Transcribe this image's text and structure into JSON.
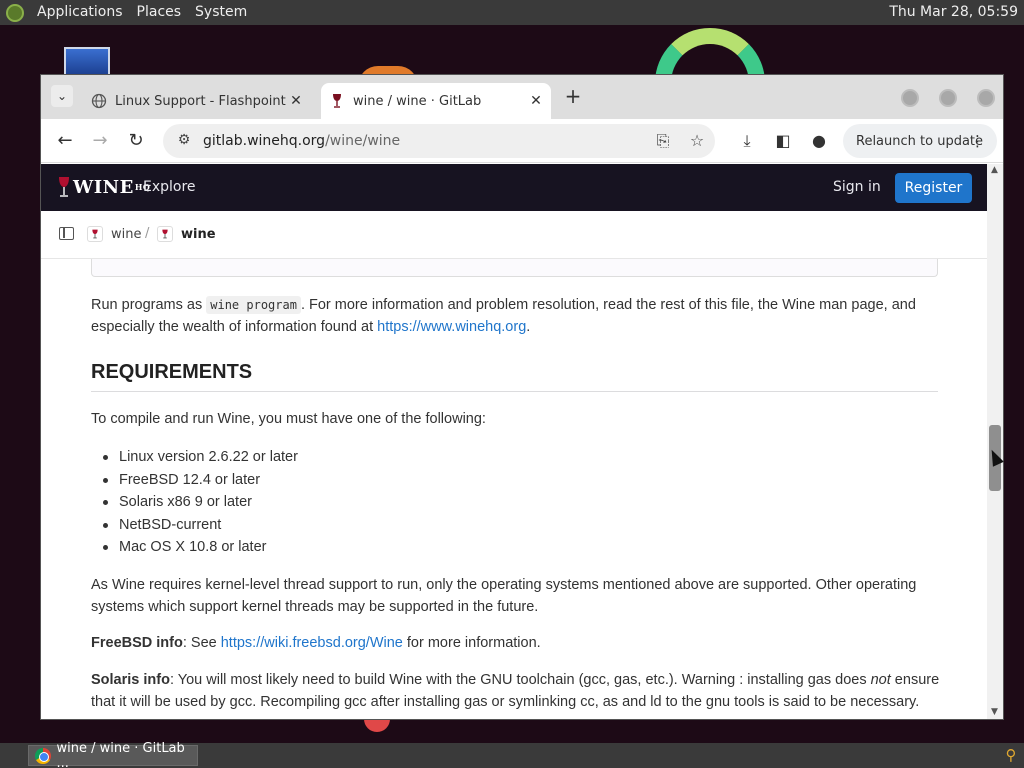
{
  "top_panel": {
    "menus": [
      "Applications",
      "Places",
      "System"
    ],
    "clock": "Thu Mar 28, 05:59"
  },
  "browser": {
    "tabs": [
      {
        "title": "Linux Support - Flashpoint Da",
        "active": false
      },
      {
        "title": "wine / wine · GitLab",
        "active": true
      }
    ],
    "url_host": "gitlab.winehq.org",
    "url_path": "/wine/wine",
    "relaunch_label": "Relaunch to update"
  },
  "gitlab": {
    "logo_text": "WINE",
    "logo_sup": "HQ",
    "explore": "Explore",
    "sign_in": "Sign in",
    "register": "Register",
    "breadcrumb": [
      "wine",
      "wine"
    ],
    "breadcrumb_sep": "/"
  },
  "content": {
    "p1_pre": "Run programs as ",
    "p1_code": "wine program",
    "p1_mid": ". For more information and problem resolution, read the rest of this file, the Wine man page, and especially the wealth of information found at ",
    "p1_link": "https://www.winehq.org",
    "p1_post": ".",
    "heading": "REQUIREMENTS",
    "p2": "To compile and run Wine, you must have one of the following:",
    "list": [
      "Linux version 2.6.22 or later",
      "FreeBSD 12.4 or later",
      "Solaris x86 9 or later",
      "NetBSD-current",
      "Mac OS X 10.8 or later"
    ],
    "p3": "As Wine requires kernel-level thread support to run, only the operating systems mentioned above are supported. Other operating systems which support kernel threads may be supported in the future.",
    "p4_bold": "FreeBSD info",
    "p4_pre": ": See ",
    "p4_link": "https://wiki.freebsd.org/Wine",
    "p4_post": " for more information.",
    "p5_bold": "Solaris info",
    "p5_text": ": You will most likely need to build Wine with the GNU toolchain (gcc, gas, etc.). Warning : installing gas does ",
    "p5_em": "not",
    "p5_text2": " ensure that it will be used by gcc. Recompiling gcc after installing gas or symlinking cc, as and ld to the gnu tools is said to be necessary."
  },
  "taskbar": {
    "item": "wine / wine · GitLab ..."
  }
}
